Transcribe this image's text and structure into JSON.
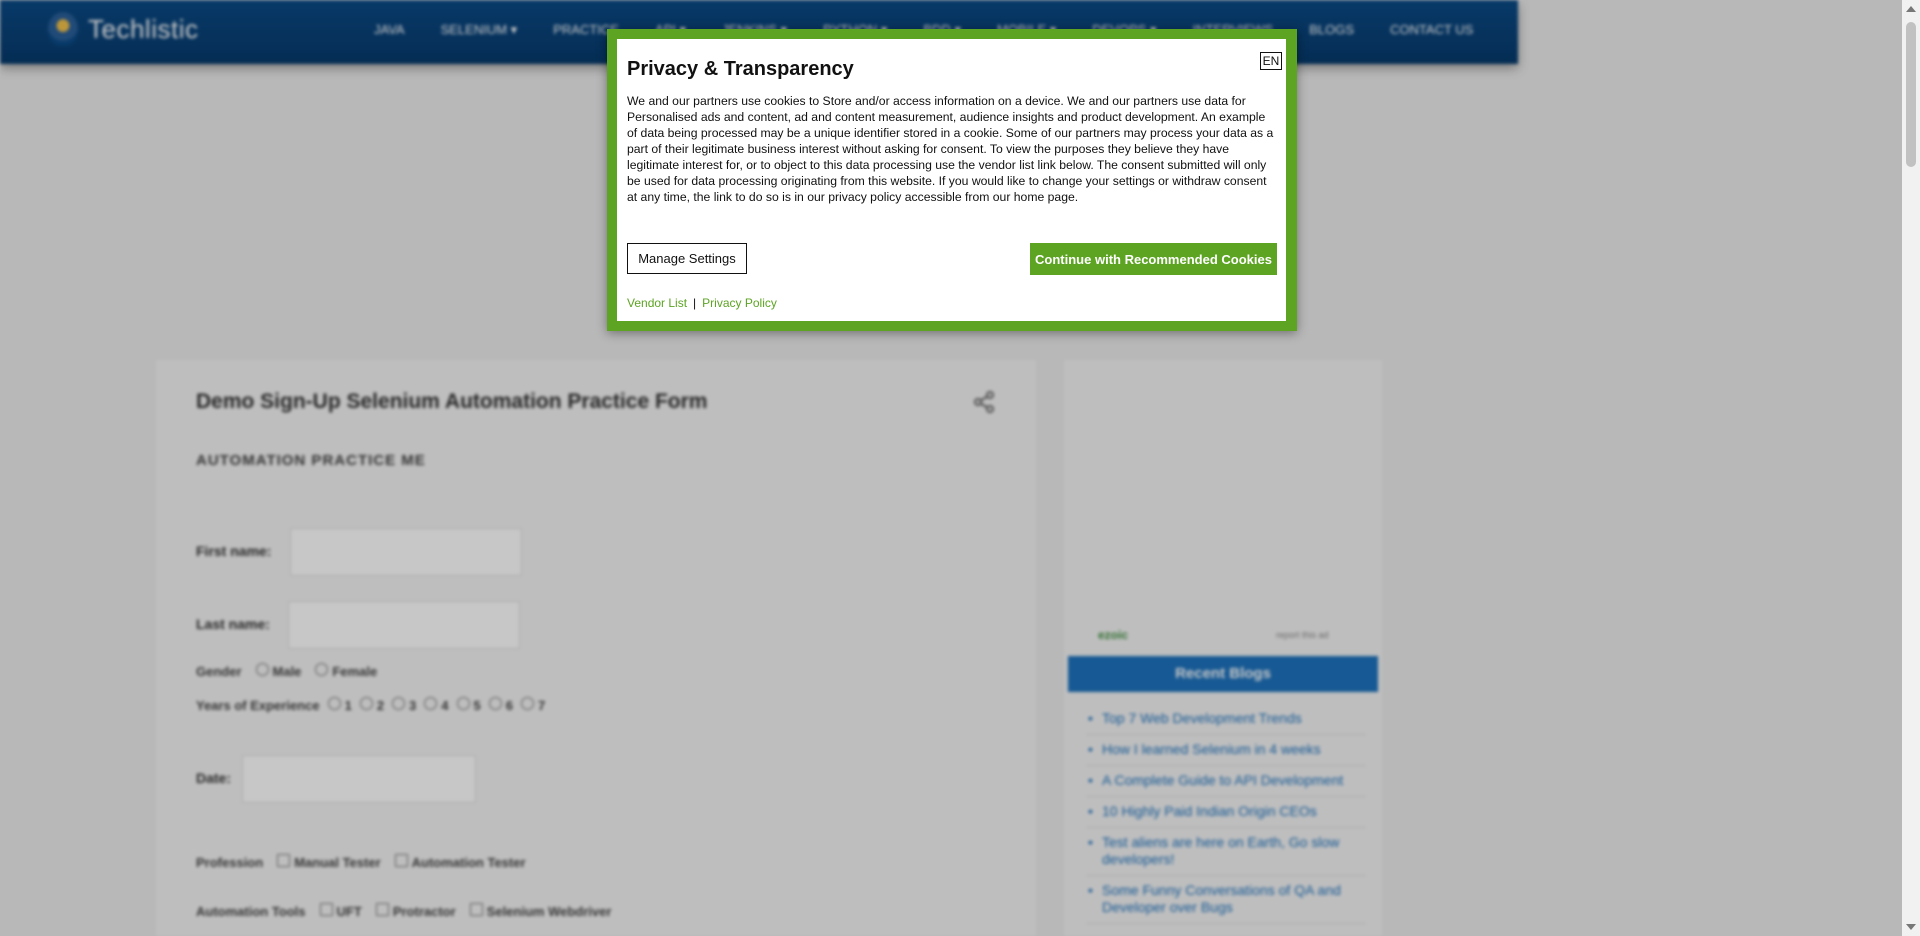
{
  "header": {
    "logo_text": "Techlistic",
    "nav": [
      "Java",
      "Selenium ▾",
      "Practice",
      "API ▾",
      "Jenkins ▾",
      "Python ▾",
      "BDD ▾",
      "Mobile ▾",
      "DevOps ▾",
      "Interviews",
      "Blogs",
      "Contact Us"
    ]
  },
  "main": {
    "title": "Demo Sign-Up Selenium Automation Practice Form",
    "subtitle": "AUTOMATION PRACTICE ME",
    "first_name_label": "First name:",
    "last_name_label": "Last name:",
    "gender_label": "Gender",
    "gender_options": [
      "Male",
      "Female"
    ],
    "experience_label": "Years of Experience",
    "experience_options": [
      "1",
      "2",
      "3",
      "4",
      "5",
      "6",
      "7"
    ],
    "date_label": "Date:",
    "profession_label": "Profession",
    "profession_options": [
      "Manual Tester",
      "Automation Tester"
    ],
    "tools_label": "Automation Tools",
    "tools_options": [
      "UFT",
      "Protractor",
      "Selenium Webdriver"
    ]
  },
  "sidebar": {
    "ad_brand": "ezoic",
    "ad_report": "report this ad",
    "recent_title": "Recent Blogs",
    "recent_items": [
      "Top 7 Web Development Trends",
      "How I learned Selenium in 4 weeks",
      "A Complete Guide to API Development",
      "10 Highly Paid Indian Origin CEOs",
      "Test aliens are here on Earth, Go slow developers!",
      "Some Funny Conversations of QA and Developer over Bugs"
    ]
  },
  "modal": {
    "title": "Privacy & Transparency",
    "lang": "EN",
    "body": "We and our partners use cookies to Store and/or access information on a device. We and our partners use data for Personalised ads and content, ad and content measurement, audience insights and product development. An example of data being processed may be a unique identifier stored in a cookie. Some of our partners may process your data as a part of their legitimate business interest without asking for consent. To view the purposes they believe they have legitimate interest for, or to object to this data processing use the vendor list link below. The consent submitted will only be used for data processing originating from this website. If you would like to change your settings or withdraw consent at any time, the link to do so is in our privacy policy accessible from our home page.",
    "manage_label": "Manage Settings",
    "continue_label": "Continue with Recommended Cookies",
    "vendor_link": "Vendor List",
    "separator": "|",
    "privacy_link": "Privacy Policy"
  },
  "colors": {
    "accent_green": "#5da423",
    "header_blue": "#0a4a86",
    "link_blue": "#1e73be"
  }
}
